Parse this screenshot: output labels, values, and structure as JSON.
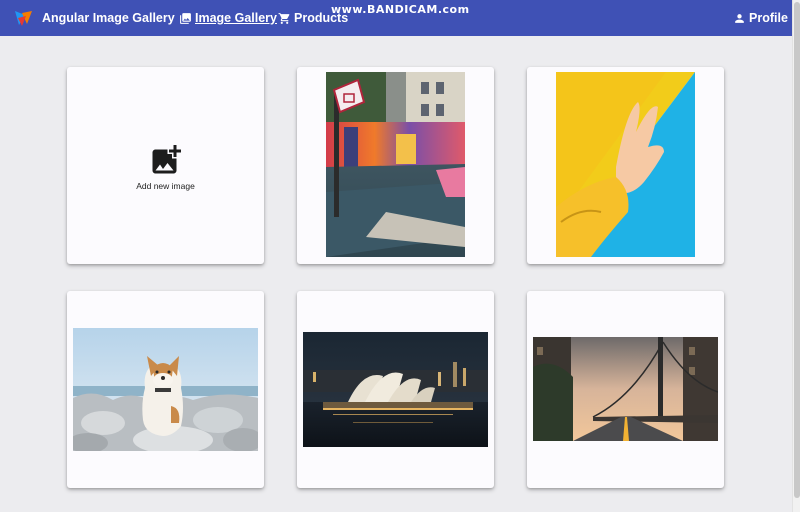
{
  "header": {
    "app_title": "Angular Image Gallery",
    "nav": [
      {
        "label": "Image Gallery",
        "icon": "photo-library-icon"
      },
      {
        "label": "Products",
        "icon": "cart-icon"
      }
    ],
    "profile_label": "Profile",
    "brand_color": "#3f51b5"
  },
  "watermark": "www.BANDICAM.com",
  "gallery": {
    "add_card": {
      "label": "Add new image",
      "icon": "add-photo-icon"
    },
    "images": [
      {
        "name": "basketball-court-photo"
      },
      {
        "name": "peace-hand-photo"
      },
      {
        "name": "dog-on-rocks-photo"
      },
      {
        "name": "sydney-opera-house-photo"
      },
      {
        "name": "bridge-sunset-photo"
      }
    ]
  }
}
